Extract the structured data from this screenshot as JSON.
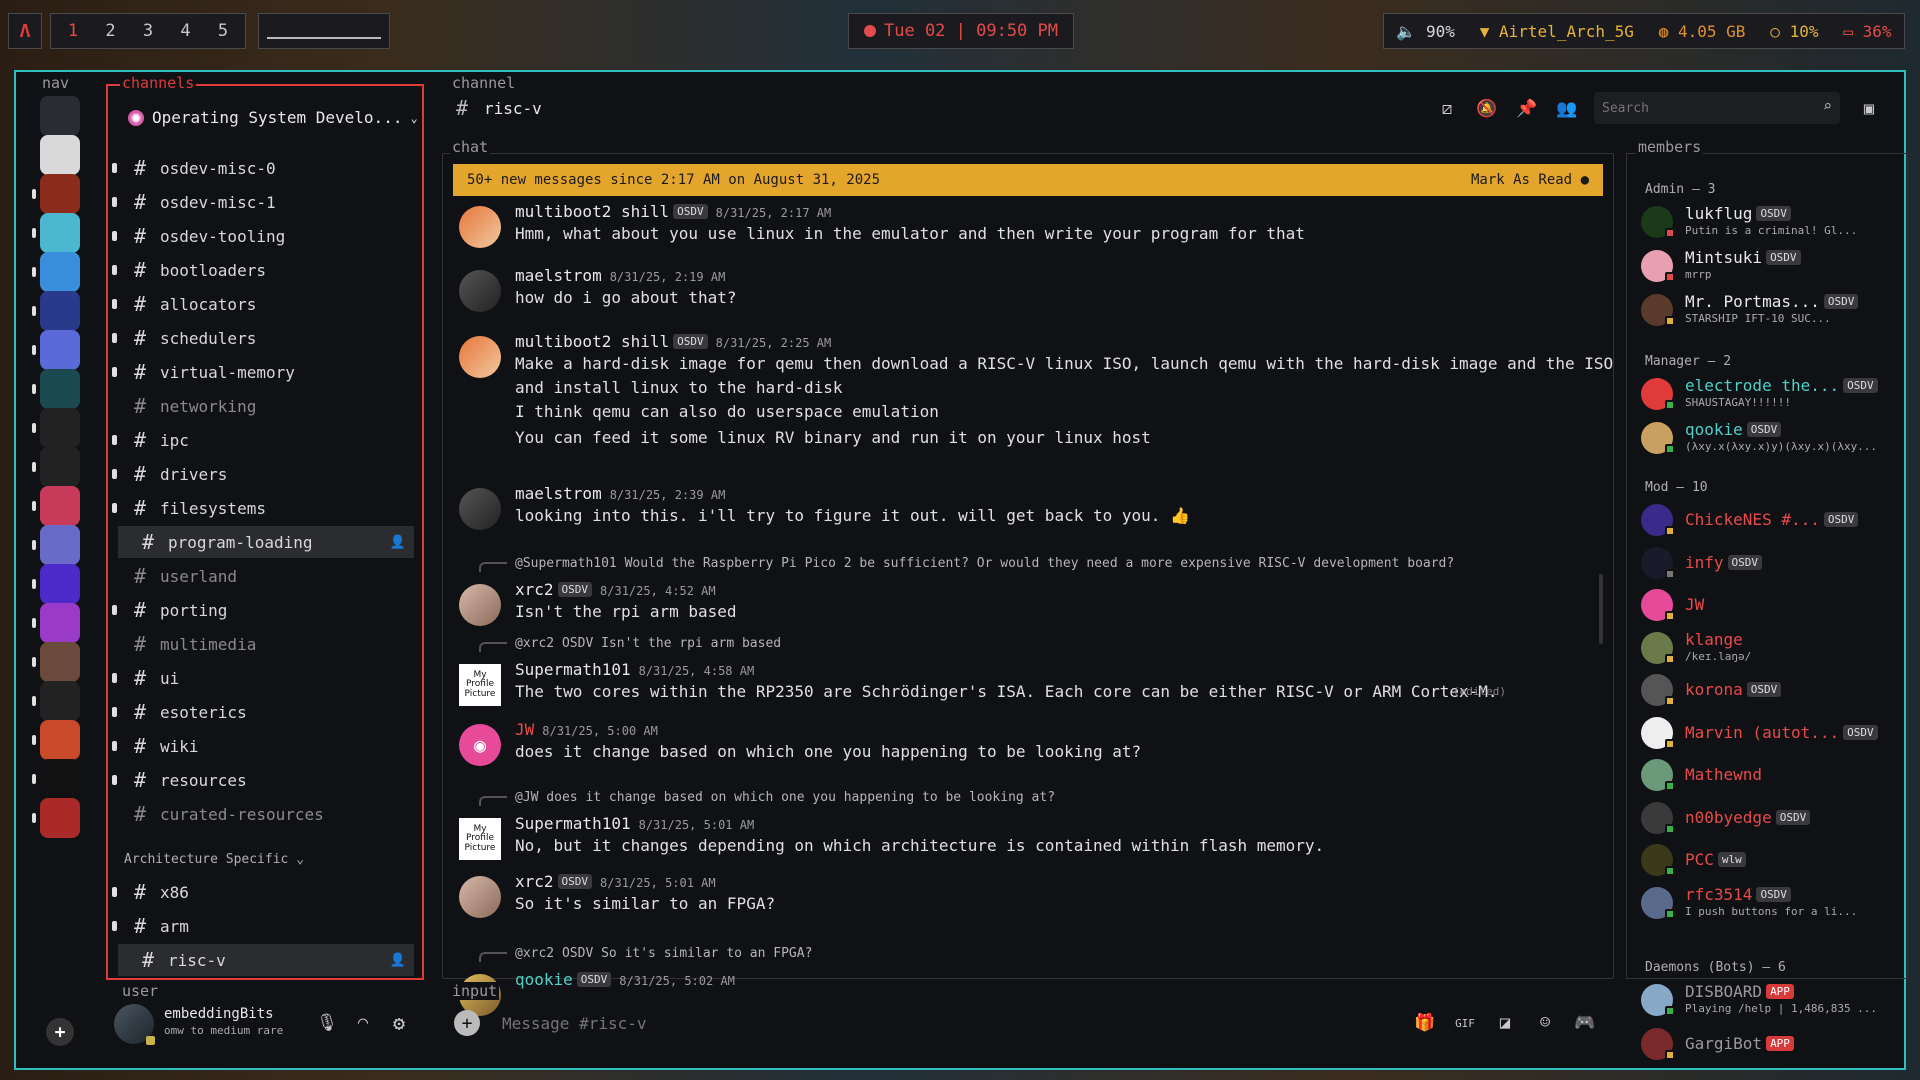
{
  "topbar": {
    "logo": "Λ",
    "workspaces": [
      "1",
      "2",
      "3",
      "4",
      "5"
    ],
    "active_workspace": "1",
    "clock": "Tue 02 | 09:50 PM",
    "volume": "90%",
    "wifi": "Airtel_Arch_5G",
    "memory": "4.05 GB",
    "cpu": "10%",
    "battery": "36%"
  },
  "nav": {
    "label": "nav"
  },
  "channels": {
    "label": "channels",
    "server_name": "Operating System Develo...",
    "items": [
      {
        "name": "osdev-misc-0",
        "state": "unread"
      },
      {
        "name": "osdev-misc-1",
        "state": "unread"
      },
      {
        "name": "osdev-tooling",
        "state": "unread"
      },
      {
        "name": "bootloaders",
        "state": "unread"
      },
      {
        "name": "allocators",
        "state": "unread"
      },
      {
        "name": "schedulers",
        "state": "unread"
      },
      {
        "name": "virtual-memory",
        "state": "unread"
      },
      {
        "name": "networking",
        "state": "read"
      },
      {
        "name": "ipc",
        "state": "unread"
      },
      {
        "name": "drivers",
        "state": "unread"
      },
      {
        "name": "filesystems",
        "state": "unread"
      },
      {
        "name": "program-loading",
        "state": "selected"
      },
      {
        "name": "userland",
        "state": "read"
      },
      {
        "name": "porting",
        "state": "unread"
      },
      {
        "name": "multimedia",
        "state": "read"
      },
      {
        "name": "ui",
        "state": "unread"
      },
      {
        "name": "esoterics",
        "state": "unread"
      },
      {
        "name": "wiki",
        "state": "unread"
      },
      {
        "name": "resources",
        "state": "unread"
      },
      {
        "name": "curated-resources",
        "state": "read"
      }
    ],
    "category": "Architecture Specific",
    "arch_items": [
      {
        "name": "x86",
        "state": "unread"
      },
      {
        "name": "arm",
        "state": "unread"
      },
      {
        "name": "risc-v",
        "state": "selected"
      }
    ]
  },
  "user": {
    "label": "user",
    "name": "embeddingBits",
    "status": "omw to medium rare"
  },
  "channel": {
    "label": "channel",
    "name": "risc-v",
    "search_placeholder": "Search"
  },
  "chat": {
    "label": "chat",
    "banner": "50+ new messages since 2:17 AM on August 31, 2025",
    "mark_read": "Mark As Read",
    "messages": [
      {
        "author": "multiboot2 shill",
        "tag": "OSDV",
        "ts": "8/31/25, 2:17 AM",
        "lines": [
          "Hmm, what about you use linux in the emulator and then write your program for that"
        ]
      },
      {
        "author": "maelstrom",
        "tag": "",
        "ts": "8/31/25, 2:19 AM",
        "lines": [
          "how do i go about that?"
        ]
      },
      {
        "author": "multiboot2 shill",
        "tag": "OSDV",
        "ts": "8/31/25, 2:25 AM",
        "lines": [
          "Make a hard-disk image for qemu then download a RISC-V linux ISO, launch qemu with the hard-disk image and the ISO",
          "and install linux to the hard-disk",
          "I think qemu can also do userspace emulation",
          "You can feed it some linux RV binary and run it on your linux host"
        ]
      },
      {
        "author": "maelstrom",
        "tag": "",
        "ts": "8/31/25, 2:39 AM",
        "lines": [
          "looking into this. i'll try to figure it out. will get back to you. 👍"
        ]
      },
      {
        "reply": "@Supermath101 Would the Raspberry Pi Pico 2 be sufficient? Or would they need a more expensive RISC-V development board?",
        "author": "xrc2",
        "tag": "OSDV",
        "ts": "8/31/25, 4:52 AM",
        "lines": [
          "Isn't the rpi arm based"
        ]
      },
      {
        "reply": "@xrc2 OSDV Isn't the rpi arm based",
        "author": "Supermath101",
        "tag": "",
        "ts": "8/31/25, 4:58 AM",
        "lines": [
          "The two cores within the RP2350 are Schrödinger's ISA. Each core can be either RISC-V or ARM Cortex-M."
        ],
        "edited": "(edited)"
      },
      {
        "author": "JW",
        "tag": "",
        "ts": "8/31/25, 5:00 AM",
        "lines": [
          "does it change based on which one you happening to be looking at?"
        ]
      },
      {
        "reply": "@JW does it change based on which one you happening to be looking at?",
        "author": "Supermath101",
        "tag": "",
        "ts": "8/31/25, 5:01 AM",
        "lines": [
          "No, but it changes depending on which architecture is contained within flash memory."
        ]
      },
      {
        "author": "xrc2",
        "tag": "OSDV",
        "ts": "8/31/25, 5:01 AM",
        "lines": [
          "So it's similar to an FPGA?"
        ]
      },
      {
        "reply": "@xrc2 OSDV So it's similar to an FPGA?",
        "author": "qookie",
        "tag": "OSDV",
        "ts": "8/31/25, 5:02 AM",
        "lines": []
      }
    ],
    "profile_placeholder": "My Profile Picture"
  },
  "members": {
    "label": "members",
    "groups": [
      {
        "title": "Admin — 3",
        "items": [
          {
            "name": "lukflug",
            "tag": "OSDV",
            "status": "Putin is a criminal! Gl...",
            "color": "#e8e8e8"
          },
          {
            "name": "Mintsuki",
            "tag": "OSDV",
            "status": "mrrp",
            "color": "#e8e8e8"
          },
          {
            "name": "Mr. Portmas...",
            "tag": "OSDV",
            "status": "STARSHIP IFT-10 SUC...",
            "color": "#e8e8e8"
          }
        ]
      },
      {
        "title": "Manager — 2",
        "items": [
          {
            "name": "electrode the...",
            "tag": "OSDV",
            "status": "SHAUSTAGAY!!!!!!",
            "color": "#4fd0c8"
          },
          {
            "name": "qookie",
            "tag": "OSDV",
            "status": "(λxy.x(λxy.x)y)(λxy.x)(λxy...",
            "color": "#4fd0c8"
          }
        ]
      },
      {
        "title": "Mod — 10",
        "items": [
          {
            "name": "ChickeNES #...",
            "tag": "OSDV",
            "status": "",
            "color": "#e84a4a"
          },
          {
            "name": "infy",
            "tag": "OSDV",
            "status": "",
            "color": "#e84a4a"
          },
          {
            "name": "JW",
            "tag": "",
            "status": "",
            "color": "#e84a4a"
          },
          {
            "name": "klange",
            "tag": "",
            "status": "/keɪ.laŋə/",
            "color": "#e84a4a"
          },
          {
            "name": "korona",
            "tag": "OSDV",
            "status": "",
            "color": "#e84a4a"
          },
          {
            "name": "Marvin (autot...",
            "tag": "OSDV",
            "status": "",
            "color": "#e84a4a"
          },
          {
            "name": "Mathewnd",
            "tag": "",
            "status": "",
            "color": "#e84a4a"
          },
          {
            "name": "n00byedge",
            "tag": "OSDV",
            "status": "",
            "color": "#e84a4a"
          },
          {
            "name": "PCC",
            "tag": "wlw",
            "status": "",
            "color": "#e84a4a"
          },
          {
            "name": "rfc3514",
            "tag": "OSDV",
            "status": "I push buttons for a li...",
            "color": "#e84a4a"
          }
        ]
      },
      {
        "title": "Daemons (Bots) — 6",
        "items": [
          {
            "name": "DISBOARD",
            "tag": "APP",
            "status": "Playing /help | 1,486,835 ...",
            "color": "#9a9a9a"
          },
          {
            "name": "GargiBot",
            "tag": "APP",
            "status": "",
            "color": "#9a9a9a"
          }
        ]
      }
    ]
  },
  "input": {
    "label": "input",
    "placeholder": "Message #risc-v"
  }
}
